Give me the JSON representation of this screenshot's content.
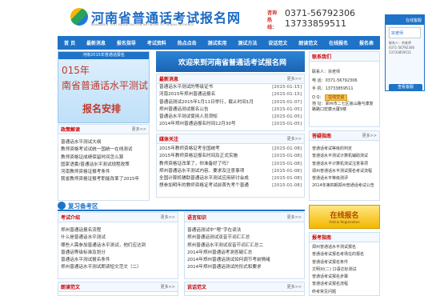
{
  "header": {
    "title": "河南省普通话考试报名网",
    "subtitle": "MANDARIN TEST REGISTRATION NETWORK OF HENAN PROVINCE",
    "hotline_label": "咨询热线：",
    "phone1": "0371-56792306",
    "phone2": "13733859511"
  },
  "nav": [
    "首 页",
    "最新消息",
    "报名指导",
    "考试资料",
    "热点点击",
    "测试实用",
    "测试方法",
    "说话范文",
    "朗读范文",
    "在线报名",
    "报名表"
  ],
  "float": {
    "head": "在线客服",
    "qq": "宗老师",
    "btn": "查看客服"
  },
  "banner": {
    "top": "河南2015年普通话报名",
    "l1": "015年",
    "l2": "南省普通话水平测试",
    "l3": "报名安排"
  },
  "welcome": "欢迎来到河南省普通话考试报名网",
  "news": {
    "title": "最新消息",
    "more": "更多>>",
    "items": [
      {
        "t": "普通话水平测试的等级证书",
        "d": "[2015-01-15]"
      },
      {
        "t": "河南2015年郑州普通话报名",
        "d": "[2015-01-15]"
      },
      {
        "t": "普通话测试2015年1月11日举行，截止时间1月",
        "d": "[2015-01-07]"
      },
      {
        "t": "郑州普通话测试报名公告",
        "d": "[2015-01-05]"
      },
      {
        "t": "普通话水平测试使用人员须知",
        "d": "[2015-01-05]"
      },
      {
        "t": "2014年郑州普通话报名时间12月30号",
        "d": "[2015-01-05]"
      }
    ]
  },
  "media": {
    "title": "媒体关注",
    "more": "更多>>",
    "items": [
      {
        "t": "2015年教师资格证考全国统考",
        "d": "[2015-01-08]"
      },
      {
        "t": "2015年教师资格证报名时间及正式实施",
        "d": "[2015-01-08]"
      },
      {
        "t": "教师资格证改革了，你准备好了吗？",
        "d": "[2015-01-08]"
      },
      {
        "t": "郑州普通话水平测试内容、要求及注意事项",
        "d": "[2015-01-08]"
      },
      {
        "t": "全国计算机辅助普通话水平测试应用研讨会成",
        "d": "[2015-01-08]"
      },
      {
        "t": "想参加明年的教师资格证考试前首先考个普通",
        "d": "[2015-01-08]"
      }
    ]
  },
  "policy": {
    "title": "政策解读",
    "more": "更多>>",
    "items": [
      "普通话水平测试大纲",
      "教师资格考试试统一国统一在线测试",
      "教师资格证成绩保留时间怎么算",
      "国家语委/普通话水平测试规程政策",
      "河南教师资格证报考条件",
      "我省教师资格证报考职能改革了2015年"
    ]
  },
  "contact": {
    "title": "联系我们",
    "teacher_label": "联系人：",
    "teacher": "宗老师",
    "phone_label": "电 话：",
    "phone": "0371-56792306",
    "mobile_label": "手 机：",
    "mobile": "13733859511",
    "qq_label": "Q Q：",
    "qq_btn": "在线交谈",
    "addr_label": "地 址：",
    "addr": "郑州市二七区嵩山路与康复路路口宏康大厦9楼"
  },
  "faq": {
    "title": "答疑指南",
    "more": "更多>>",
    "items": [
      "普通话考试等级的判定",
      "普通话水平测试计算机辅助测试",
      "普通话水平计算机测试注意事项",
      "郑州普通话水平测试报名考试流程",
      "普通话水平等级测评",
      "2014年第四期郑州普通话考试公告"
    ]
  },
  "review": {
    "title": "复习备考区"
  },
  "exam": {
    "title": "考试介绍",
    "more": "更多>>",
    "items": [
      "郑州普通话报名流程",
      "什么是普通话水平测试",
      "哪些人需参加普通话水平测试，他们应达到",
      "普通话等级标准及划分",
      "普通话水平测试报名条件",
      "郑州普通话水平测试朗读短文范文（二）"
    ]
  },
  "lang": {
    "title": "语言知识",
    "more": "更多>>",
    "items": [
      "普通话测试中“嗯”字在读法",
      "郑州普通话测试双音节词汇汇总",
      "郑州普通话水平测试双音节词汇汇总二",
      "2014年郑州普通话考测答疑汇总",
      "2014年郑州普通话测试如何调节考前情绪",
      "2014年郑州普通话测试的形式和要求"
    ]
  },
  "reading": {
    "title": "朗读范文",
    "more": "更多>>"
  },
  "speech": {
    "title": "说话范文",
    "more": "更多>>"
  },
  "signup": {
    "label": "在线报名",
    "sub": "Online Registration"
  },
  "guide": {
    "title": "报考指南",
    "items": [
      "郑州普通话水平测试报名",
      "普通话考试报名考场在的报名",
      "普通话考试报名条件",
      "文明对(二) 口语达标测试",
      "普通话考试报名步骤",
      "普通话考试报名流程",
      "终考常见问题"
    ]
  }
}
